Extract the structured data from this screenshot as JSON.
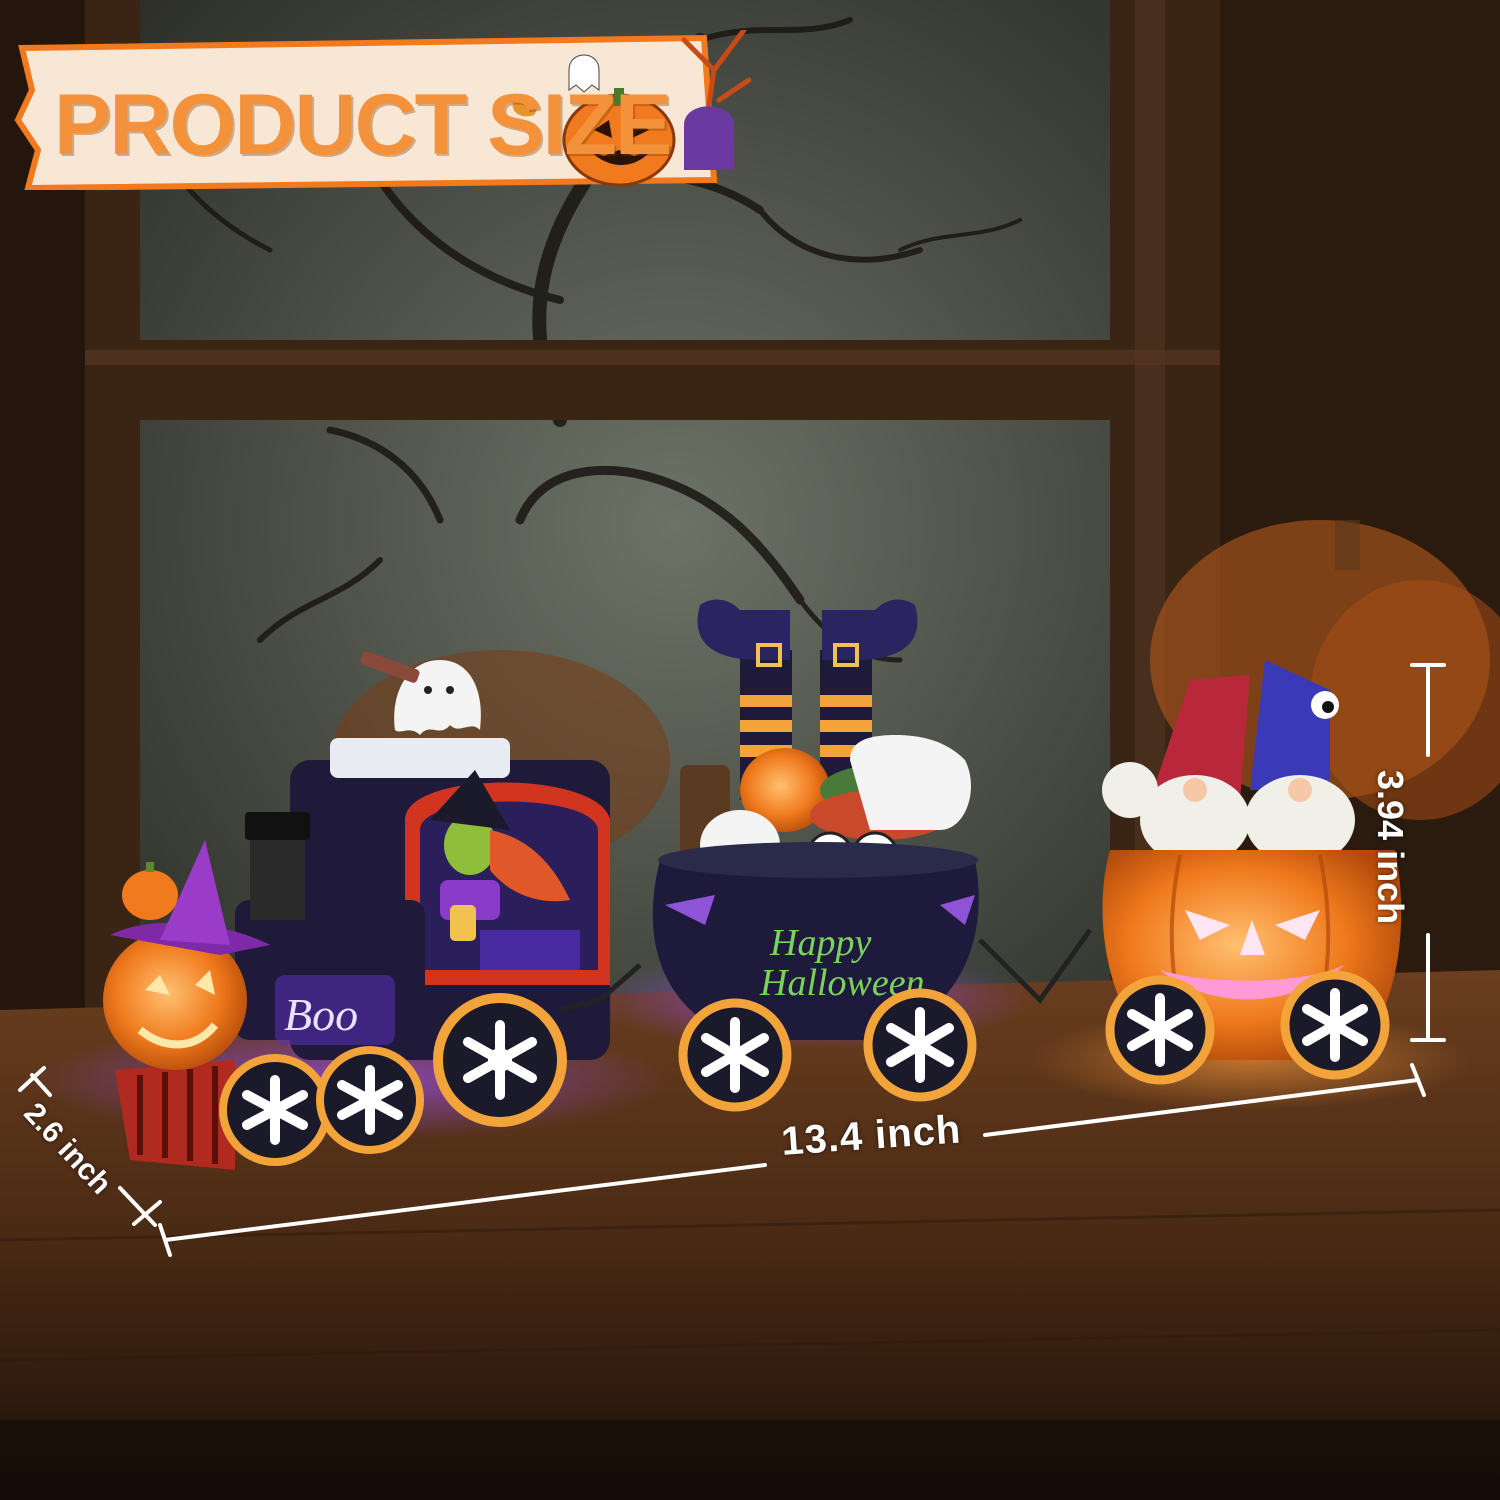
{
  "banner": {
    "title": "PRODUCT SIZE"
  },
  "dimensions": {
    "length": "13.4 inch",
    "height": "3.94 inch",
    "depth": "2.6 inch"
  },
  "decorations": {
    "locomotive_text": "Boo",
    "cauldron_text_line1": "Happy",
    "cauldron_text_line2": "Halloween"
  },
  "icons": [
    "pumpkin-icon",
    "ghost-icon",
    "tombstone-icon",
    "bare-tree-icon",
    "leaf-icon"
  ],
  "colors": {
    "banner_orange": "#f3923a",
    "banner_bg": "#f7e7d4",
    "pumpkin": "#f07a1d",
    "train_dark": "#1f1a3a",
    "purple_glow": "#8a3cff",
    "wood": "#5a3218"
  }
}
